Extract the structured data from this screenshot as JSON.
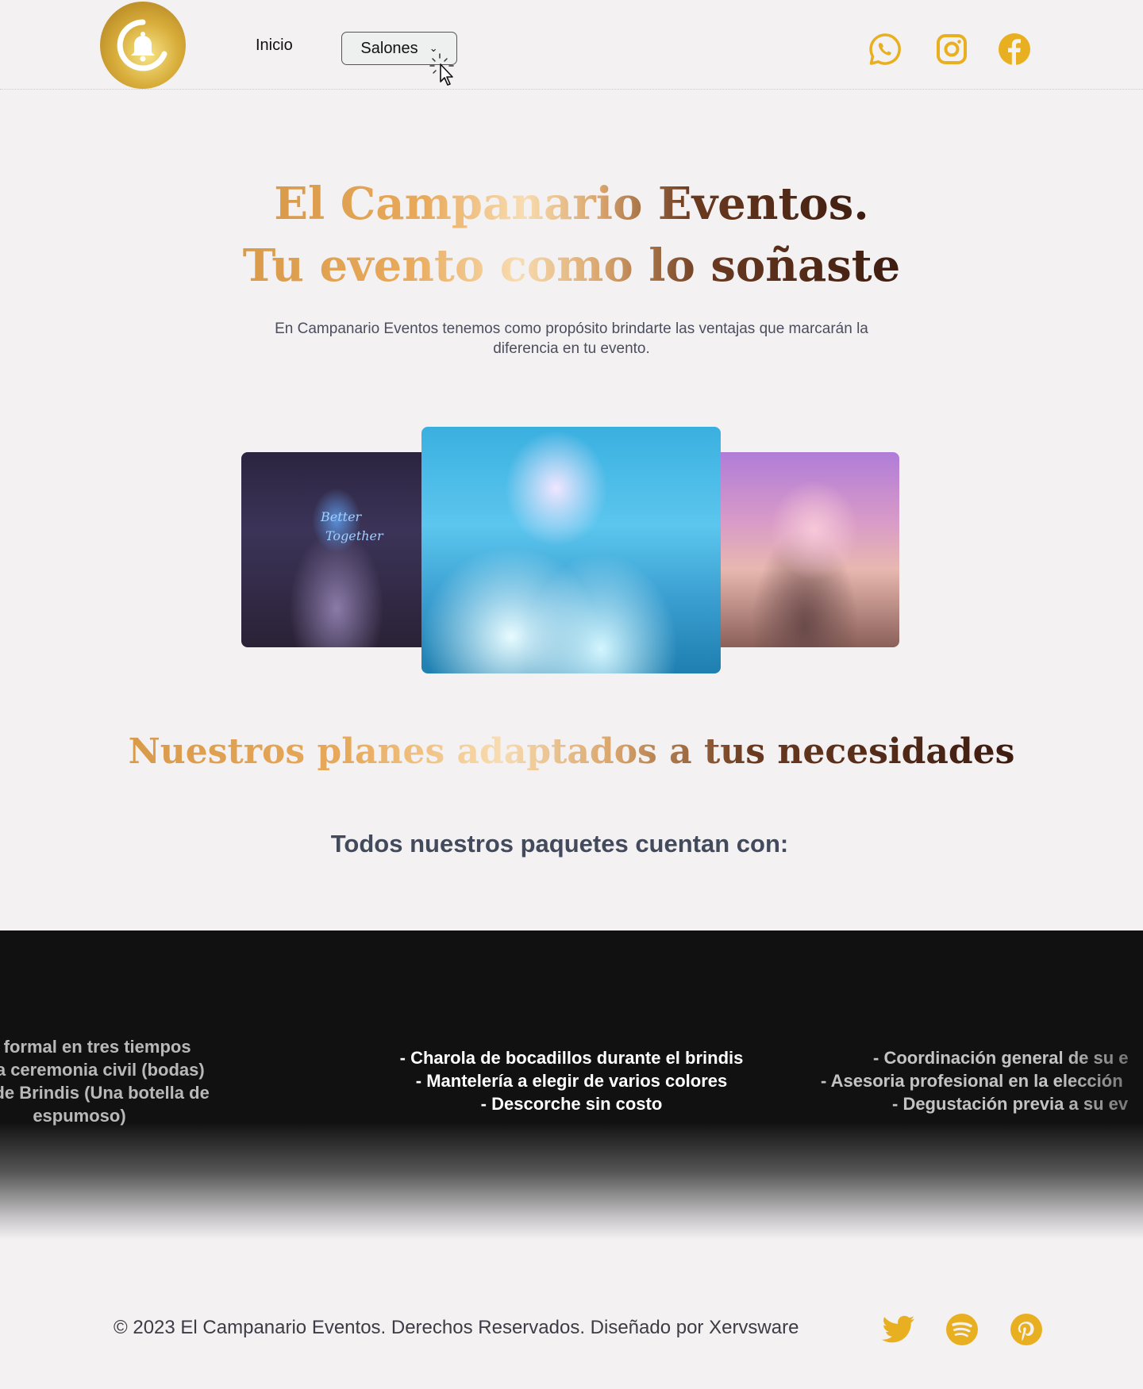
{
  "header": {
    "logo_alt": "El Campanario Eventos",
    "nav_inicio": "Inicio",
    "nav_salones": "Salones",
    "social_icons": [
      "whatsapp-icon",
      "instagram-icon",
      "facebook-icon"
    ]
  },
  "hero": {
    "title_line1": "El Campanario Eventos.",
    "title_line2": "Tu evento como lo soñaste",
    "subtitle": "En Campanario Eventos tenemos como propósito brindarte las ventajas que marcarán la diferencia en tu evento."
  },
  "gallery": {
    "left_sign_line1": "Better",
    "left_sign_line2": "Together"
  },
  "plans": {
    "title": "Nuestros planes adaptados a tus necesidades",
    "subtitle": "Todos nuestros paquetes cuentan con:"
  },
  "features": {
    "col1": [
      "enú formal en tres tiempos",
      "a para ceremonia civil (bodas)",
      "vicio de Brindis (Una botella de",
      "espumoso)"
    ],
    "col2": [
      "- Charola de bocadillos durante el brindis",
      "- Mantelería a elegir de varios colores",
      "- Descorche sin costo"
    ],
    "col3": [
      "- Coordinación general de su e",
      "- Asesoria profesional en la elección",
      "- Degustación previa a su ev"
    ]
  },
  "footer": {
    "copyright": "© 2023 El Campanario Eventos. Derechos Reservados. Diseñado por Xervsware",
    "icons": [
      "twitter-icon",
      "spotify-icon",
      "pinterest-icon"
    ]
  },
  "colors": {
    "accent_gold": "#e8b020",
    "background": "#f4f1f3",
    "band": "#111111"
  }
}
